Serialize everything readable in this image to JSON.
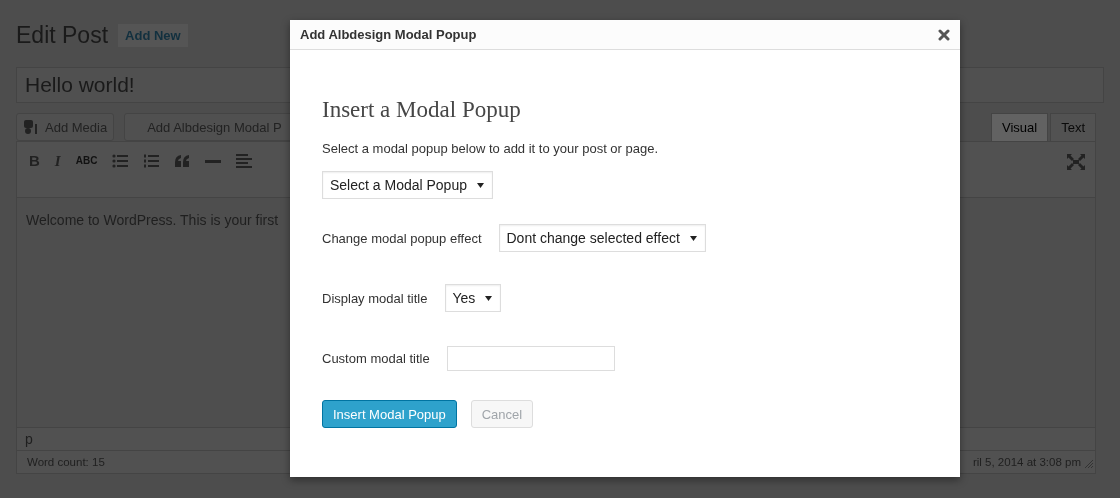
{
  "page": {
    "title": "Edit Post",
    "add_new": "Add New",
    "post_title": "Hello world!",
    "buttons": [
      {
        "label": "Add Media",
        "kind": "media"
      },
      {
        "label": "Add Albdesign Modal P",
        "kind": "plain"
      }
    ],
    "tabs": [
      {
        "label": "Visual",
        "selected": true
      },
      {
        "label": "Text",
        "selected": false
      }
    ],
    "toolbar": [
      {
        "kind": "bold",
        "glyph": "B"
      },
      {
        "kind": "italic",
        "glyph": "I"
      },
      {
        "kind": "strike",
        "glyph": "ABC"
      },
      {
        "kind": "bullets"
      },
      {
        "kind": "numbers"
      },
      {
        "kind": "quote"
      },
      {
        "kind": "hr"
      },
      {
        "kind": "align-left"
      }
    ],
    "content": "Welcome to WordPress. This is your first",
    "path": "p",
    "word_count": "Word count: 15",
    "last_edited": "ril 5, 2014 at 3:08 pm"
  },
  "modal": {
    "title": "Add Albdesign Modal Popup",
    "heading": "Insert a Modal Popup",
    "intro": "Select a modal popup below to add it to your post or page.",
    "popup_select": "Select a Modal Popup",
    "fields": [
      {
        "kind": "select",
        "label": "Change modal popup effect",
        "value": "Dont change selected effect"
      },
      {
        "kind": "select",
        "label": "Display modal title",
        "value": "Yes"
      },
      {
        "kind": "input",
        "label": "Custom modal title"
      }
    ],
    "buttons": [
      {
        "label": "Insert Modal Popup",
        "kind": "primary",
        "disabled": false
      },
      {
        "label": "Cancel",
        "kind": "secondary",
        "disabled": true
      }
    ]
  }
}
